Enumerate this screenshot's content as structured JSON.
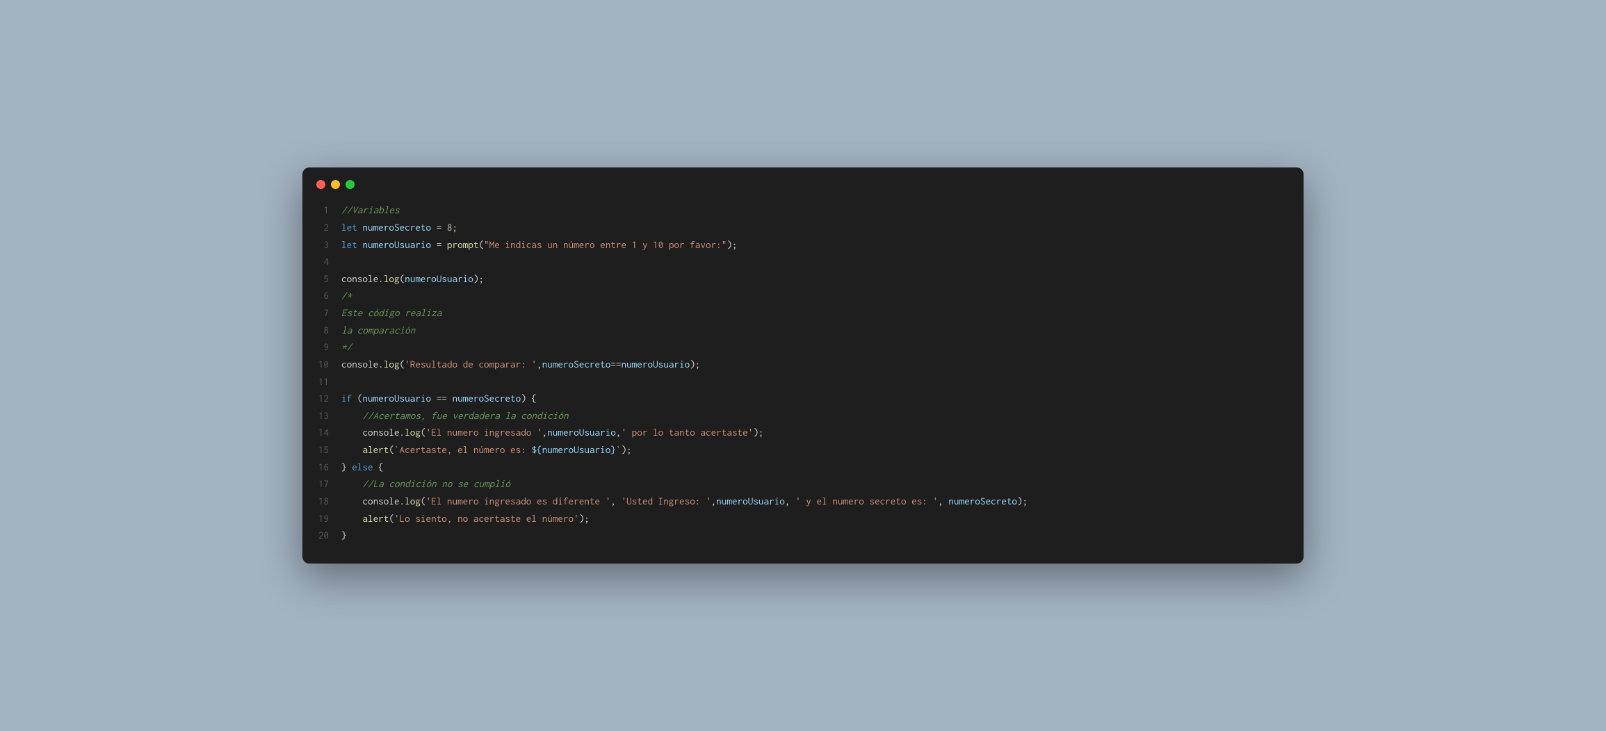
{
  "theme": {
    "background_outer": "#a3b3c2",
    "background_editor": "#1e1e1e",
    "gutter_color": "#5a5a5a",
    "traffic_red": "#ff5f56",
    "traffic_yellow": "#ffbd2e",
    "traffic_green": "#27c93f"
  },
  "lines": [
    {
      "n": "1",
      "tokens": [
        {
          "t": "//Variables",
          "c": "comment"
        }
      ]
    },
    {
      "n": "2",
      "tokens": [
        {
          "t": "let ",
          "c": "keyword"
        },
        {
          "t": "numeroSecreto",
          "c": "variable"
        },
        {
          "t": " = ",
          "c": "operator"
        },
        {
          "t": "8",
          "c": "number"
        },
        {
          "t": ";",
          "c": "punct"
        }
      ]
    },
    {
      "n": "3",
      "tokens": [
        {
          "t": "let ",
          "c": "keyword"
        },
        {
          "t": "numeroUsuario",
          "c": "variable"
        },
        {
          "t": " = ",
          "c": "operator"
        },
        {
          "t": "prompt",
          "c": "function"
        },
        {
          "t": "(",
          "c": "paren"
        },
        {
          "t": "\"Me indicas un número entre 1 y 10 por favor:\"",
          "c": "string"
        },
        {
          "t": ")",
          "c": "paren"
        },
        {
          "t": ";",
          "c": "punct"
        }
      ]
    },
    {
      "n": "4",
      "tokens": []
    },
    {
      "n": "5",
      "tokens": [
        {
          "t": "console",
          "c": "object"
        },
        {
          "t": ".",
          "c": "punct"
        },
        {
          "t": "log",
          "c": "function"
        },
        {
          "t": "(",
          "c": "paren"
        },
        {
          "t": "numeroUsuario",
          "c": "variable"
        },
        {
          "t": ")",
          "c": "paren"
        },
        {
          "t": ";",
          "c": "punct"
        }
      ]
    },
    {
      "n": "6",
      "tokens": [
        {
          "t": "/*",
          "c": "comment"
        }
      ]
    },
    {
      "n": "7",
      "tokens": [
        {
          "t": "Este código realiza",
          "c": "comment"
        }
      ]
    },
    {
      "n": "8",
      "tokens": [
        {
          "t": "la comparación",
          "c": "comment"
        }
      ]
    },
    {
      "n": "9",
      "tokens": [
        {
          "t": "*/",
          "c": "comment"
        }
      ]
    },
    {
      "n": "10",
      "tokens": [
        {
          "t": "console",
          "c": "object"
        },
        {
          "t": ".",
          "c": "punct"
        },
        {
          "t": "log",
          "c": "function"
        },
        {
          "t": "(",
          "c": "paren"
        },
        {
          "t": "'Resultado de comparar: '",
          "c": "string"
        },
        {
          "t": ",",
          "c": "punct"
        },
        {
          "t": "numeroSecreto",
          "c": "variable"
        },
        {
          "t": "==",
          "c": "operator"
        },
        {
          "t": "numeroUsuario",
          "c": "variable"
        },
        {
          "t": ")",
          "c": "paren"
        },
        {
          "t": ";",
          "c": "punct"
        }
      ]
    },
    {
      "n": "11",
      "tokens": []
    },
    {
      "n": "12",
      "tokens": [
        {
          "t": "if ",
          "c": "keyword"
        },
        {
          "t": "(",
          "c": "paren"
        },
        {
          "t": "numeroUsuario",
          "c": "variable"
        },
        {
          "t": " == ",
          "c": "operator"
        },
        {
          "t": "numeroSecreto",
          "c": "variable"
        },
        {
          "t": ")",
          "c": "paren"
        },
        {
          "t": " {",
          "c": "punct"
        }
      ]
    },
    {
      "n": "13",
      "tokens": [
        {
          "t": "    ",
          "c": "punct"
        },
        {
          "t": "//Acertamos, fue verdadera la condición",
          "c": "comment"
        }
      ]
    },
    {
      "n": "14",
      "tokens": [
        {
          "t": "    ",
          "c": "punct"
        },
        {
          "t": "console",
          "c": "object"
        },
        {
          "t": ".",
          "c": "punct"
        },
        {
          "t": "log",
          "c": "function"
        },
        {
          "t": "(",
          "c": "paren"
        },
        {
          "t": "'El numero ingresado '",
          "c": "string"
        },
        {
          "t": ",",
          "c": "punct"
        },
        {
          "t": "numeroUsuario",
          "c": "variable"
        },
        {
          "t": ",",
          "c": "punct"
        },
        {
          "t": "' por lo tanto acertaste'",
          "c": "string"
        },
        {
          "t": ")",
          "c": "paren"
        },
        {
          "t": ";",
          "c": "punct"
        }
      ]
    },
    {
      "n": "15",
      "tokens": [
        {
          "t": "    ",
          "c": "punct"
        },
        {
          "t": "alert",
          "c": "function"
        },
        {
          "t": "(",
          "c": "paren"
        },
        {
          "t": "`Acertaste, el número es: ",
          "c": "string"
        },
        {
          "t": "${",
          "c": "template"
        },
        {
          "t": "numeroUsuario",
          "c": "variable"
        },
        {
          "t": "}",
          "c": "template"
        },
        {
          "t": "`",
          "c": "string"
        },
        {
          "t": ")",
          "c": "paren"
        },
        {
          "t": ";",
          "c": "punct"
        }
      ]
    },
    {
      "n": "16",
      "tokens": [
        {
          "t": "} ",
          "c": "punct"
        },
        {
          "t": "else",
          "c": "keyword"
        },
        {
          "t": " {",
          "c": "punct"
        }
      ]
    },
    {
      "n": "17",
      "tokens": [
        {
          "t": "    ",
          "c": "punct"
        },
        {
          "t": "//La condición no se cumplió",
          "c": "comment"
        }
      ]
    },
    {
      "n": "18",
      "tokens": [
        {
          "t": "    ",
          "c": "punct"
        },
        {
          "t": "console",
          "c": "object"
        },
        {
          "t": ".",
          "c": "punct"
        },
        {
          "t": "log",
          "c": "function"
        },
        {
          "t": "(",
          "c": "paren"
        },
        {
          "t": "'El numero ingresado es diferente '",
          "c": "string"
        },
        {
          "t": ", ",
          "c": "punct"
        },
        {
          "t": "'Usted Ingreso: '",
          "c": "string"
        },
        {
          "t": ",",
          "c": "punct"
        },
        {
          "t": "numeroUsuario",
          "c": "variable"
        },
        {
          "t": ", ",
          "c": "punct"
        },
        {
          "t": "' y el numero secreto es: '",
          "c": "string"
        },
        {
          "t": ", ",
          "c": "punct"
        },
        {
          "t": "numeroSecreto",
          "c": "variable"
        },
        {
          "t": ")",
          "c": "paren"
        },
        {
          "t": ";",
          "c": "punct"
        }
      ]
    },
    {
      "n": "19",
      "tokens": [
        {
          "t": "    ",
          "c": "punct"
        },
        {
          "t": "alert",
          "c": "function"
        },
        {
          "t": "(",
          "c": "paren"
        },
        {
          "t": "'Lo siento, no acertaste el número'",
          "c": "string"
        },
        {
          "t": ")",
          "c": "paren"
        },
        {
          "t": ";",
          "c": "punct"
        }
      ]
    },
    {
      "n": "20",
      "tokens": [
        {
          "t": "}",
          "c": "punct"
        }
      ]
    }
  ]
}
